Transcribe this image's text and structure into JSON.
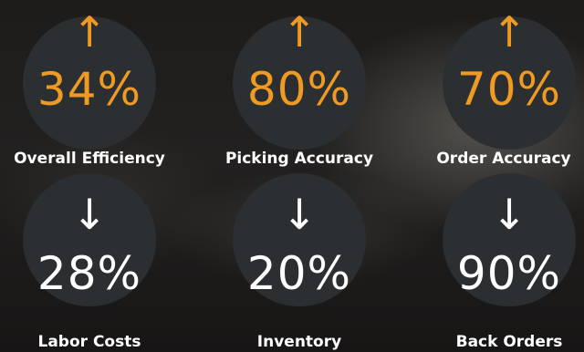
{
  "accent_color": "#ef9a22",
  "text_color": "#ffffff",
  "circle_color": "#2b2f31",
  "stats": [
    {
      "label": "Overall Efficiency",
      "value": "34%",
      "direction": "up",
      "arrow": "↑",
      "arrow_icon": "arrow-up-icon"
    },
    {
      "label": "Picking Accuracy",
      "value": "80%",
      "direction": "up",
      "arrow": "↑",
      "arrow_icon": "arrow-up-icon"
    },
    {
      "label": "Order Accuracy",
      "value": "70%",
      "direction": "up",
      "arrow": "↑",
      "arrow_icon": "arrow-up-icon"
    },
    {
      "label": "Labor Costs",
      "value": "28%",
      "direction": "down",
      "arrow": "↓",
      "arrow_icon": "arrow-down-icon"
    },
    {
      "label": "Inventory",
      "value": "20%",
      "direction": "down",
      "arrow": "↓",
      "arrow_icon": "arrow-down-icon"
    },
    {
      "label": "Back Orders",
      "value": "90%",
      "direction": "down",
      "arrow": "↓",
      "arrow_icon": "arrow-down-icon"
    }
  ]
}
